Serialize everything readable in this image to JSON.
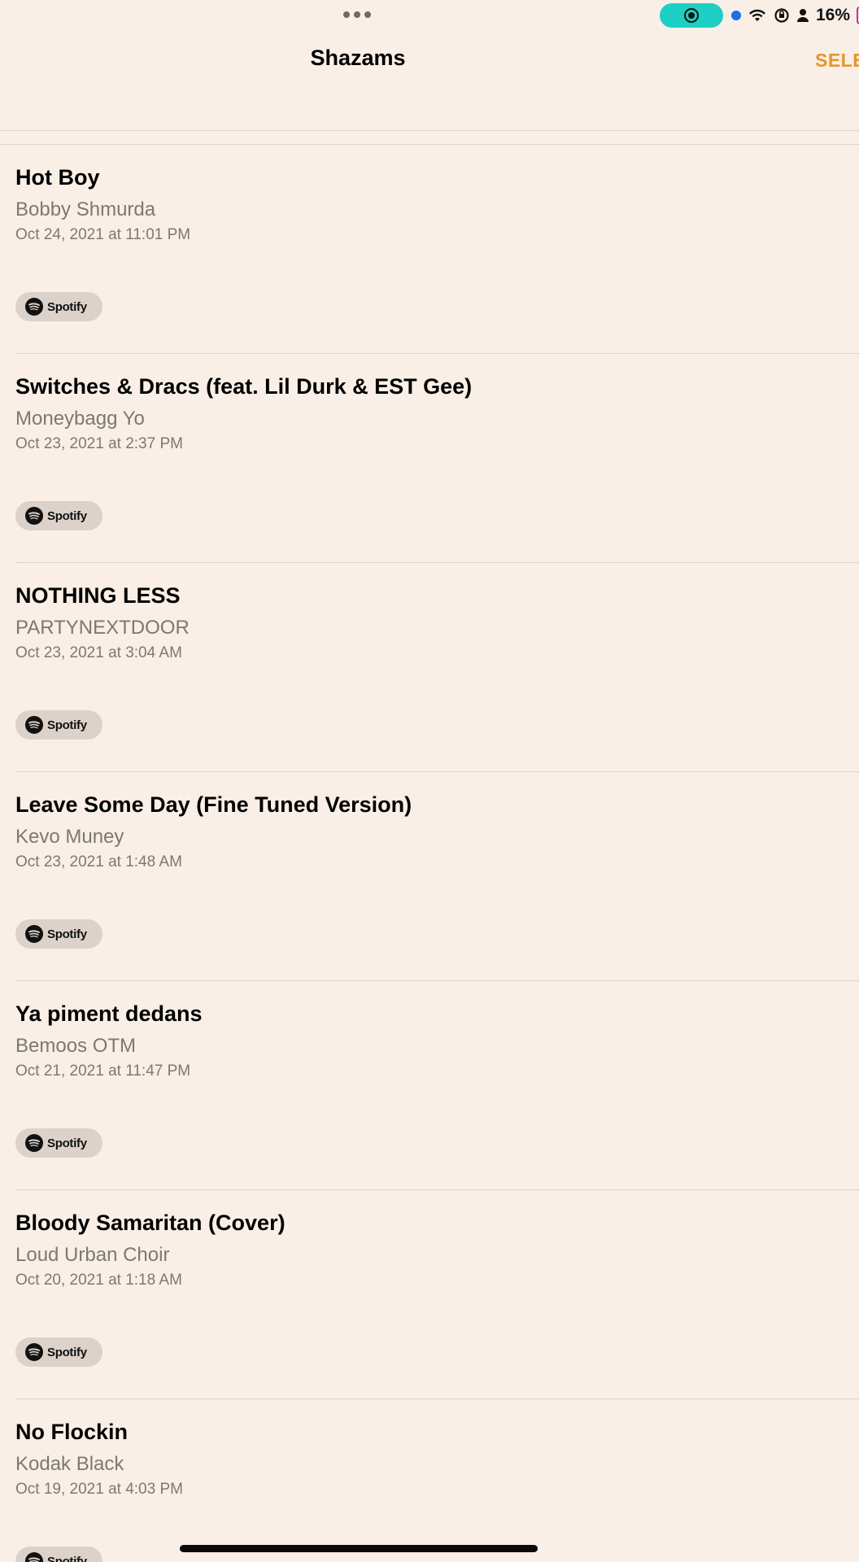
{
  "status_bar": {
    "battery_percent": "16%",
    "icons": [
      "more-dots-icon",
      "screen-record-icon",
      "location-dot-icon",
      "wifi-icon",
      "orientation-lock-icon",
      "person-icon",
      "battery-icon"
    ]
  },
  "nav": {
    "title": "Shazams",
    "select_label": "SELE"
  },
  "colors": {
    "background": "#f9efe6",
    "accent": "#e5962d",
    "record_pill": "#1ecfc3",
    "secondary_text": "#7d7874"
  },
  "shazams": [
    {
      "title": "Hot Boy",
      "artist": "Bobby Shmurda",
      "date": "Oct 24, 2021 at 11:01 PM",
      "service": "Spotify"
    },
    {
      "title": "Switches & Dracs (feat. Lil Durk & EST Gee)",
      "artist": "Moneybagg Yo",
      "date": "Oct 23, 2021 at 2:37 PM",
      "service": "Spotify"
    },
    {
      "title": "NOTHING LESS",
      "artist": "PARTYNEXTDOOR",
      "date": "Oct 23, 2021 at 3:04 AM",
      "service": "Spotify"
    },
    {
      "title": "Leave Some Day (Fine Tuned Version)",
      "artist": "Kevo Muney",
      "date": "Oct 23, 2021 at 1:48 AM",
      "service": "Spotify"
    },
    {
      "title": "Ya piment dedans",
      "artist": "Bemoos OTM",
      "date": "Oct 21, 2021 at 11:47 PM",
      "service": "Spotify"
    },
    {
      "title": "Bloody Samaritan (Cover)",
      "artist": "Loud Urban Choir",
      "date": "Oct 20, 2021 at 1:18 AM",
      "service": "Spotify"
    },
    {
      "title": "No Flockin",
      "artist": "Kodak Black",
      "date": "Oct 19, 2021 at 4:03 PM",
      "service": "Spotify"
    }
  ]
}
